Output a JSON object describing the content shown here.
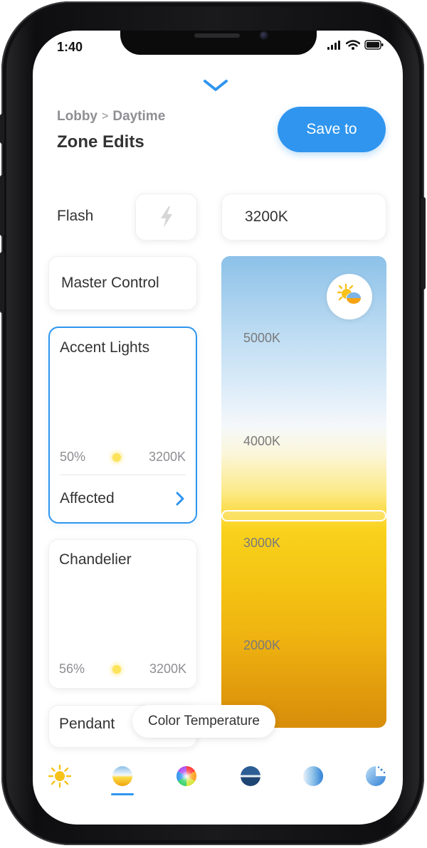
{
  "status_bar": {
    "time": "1:40"
  },
  "header": {
    "breadcrumb": [
      "Lobby",
      "Daytime"
    ],
    "breadcrumb_separator": ">",
    "title": "Zone Edits",
    "save_label": "Save to"
  },
  "flash": {
    "label": "Flash",
    "icon": "lightning-icon"
  },
  "kelvin_field": {
    "value": "3200K"
  },
  "zones": {
    "master": {
      "label": "Master Control"
    },
    "accent": {
      "label": "Accent Lights",
      "brightness": "50%",
      "temperature": "3200K",
      "affected_label": "Affected",
      "selected": true
    },
    "chandelier": {
      "label": "Chandelier",
      "brightness": "56%",
      "temperature": "3200K"
    },
    "pendant": {
      "label": "Pendant"
    }
  },
  "temperature_slider": {
    "ticks": [
      "5000K",
      "4000K",
      "3000K",
      "2000K"
    ],
    "current": "3200K",
    "icon": "sun-cloud-icon"
  },
  "tooltip": {
    "text": "Color Temperature"
  },
  "tabs": [
    {
      "icon": "sun-icon",
      "selected": false
    },
    {
      "icon": "color-temperature-icon",
      "selected": true
    },
    {
      "icon": "color-wheel-icon",
      "selected": false
    },
    {
      "icon": "half-moon-icon",
      "selected": false
    },
    {
      "icon": "gradient-circle-icon",
      "selected": false
    },
    {
      "icon": "sun-moon-icon",
      "selected": false
    }
  ],
  "colors": {
    "accent": "#2f95ee",
    "text_primary": "#333333",
    "text_secondary": "#8e8e93"
  }
}
